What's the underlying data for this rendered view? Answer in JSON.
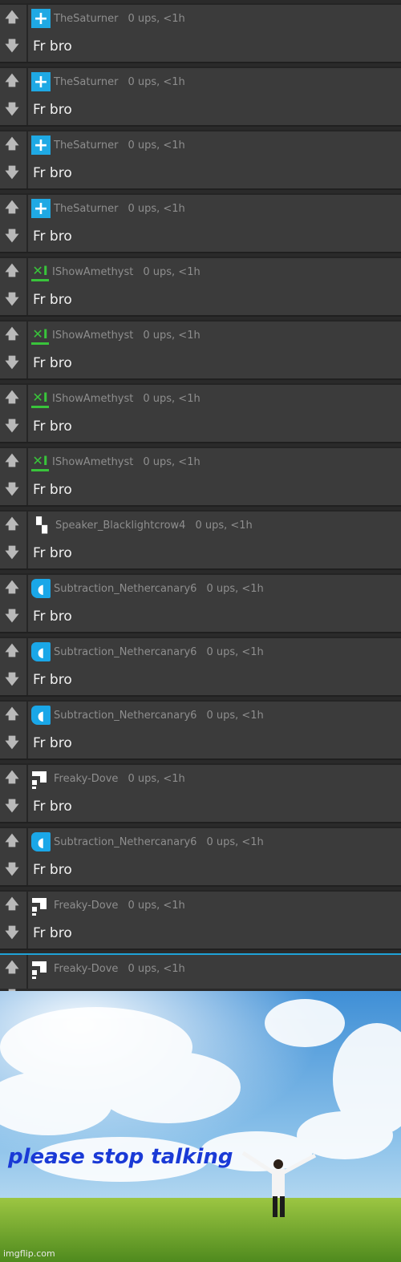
{
  "comments": [
    {
      "user": "TheSaturner",
      "meta": "0 ups, <1h",
      "text": "Fr bro",
      "avatar": "blue-plus-icon"
    },
    {
      "user": "TheSaturner",
      "meta": "0 ups, <1h",
      "text": "Fr bro",
      "avatar": "blue-plus-icon"
    },
    {
      "user": "TheSaturner",
      "meta": "0 ups, <1h",
      "text": "Fr bro",
      "avatar": "blue-plus-icon"
    },
    {
      "user": "TheSaturner",
      "meta": "0 ups, <1h",
      "text": "Fr bro",
      "avatar": "blue-plus-icon"
    },
    {
      "user": "IShowAmethyst",
      "meta": "0 ups, <1h",
      "text": "Fr bro",
      "avatar": "green-xi-icon"
    },
    {
      "user": "IShowAmethyst",
      "meta": "0 ups, <1h",
      "text": "Fr bro",
      "avatar": "green-xi-icon"
    },
    {
      "user": "IShowAmethyst",
      "meta": "0 ups, <1h",
      "text": "Fr bro",
      "avatar": "green-xi-icon"
    },
    {
      "user": "IShowAmethyst",
      "meta": "0 ups, <1h",
      "text": "Fr bro",
      "avatar": "green-xi-icon"
    },
    {
      "user": "Speaker_Blacklightcrow4",
      "meta": "0 ups, <1h",
      "text": "Fr bro",
      "avatar": "white-speaker-icon"
    },
    {
      "user": "Subtraction_Nethercanary6",
      "meta": "0 ups, <1h",
      "text": "Fr bro",
      "avatar": "blue-pixel-icon"
    },
    {
      "user": "Subtraction_Nethercanary6",
      "meta": "0 ups, <1h",
      "text": "Fr bro",
      "avatar": "blue-pixel-icon"
    },
    {
      "user": "Subtraction_Nethercanary6",
      "meta": "0 ups, <1h",
      "text": "Fr bro",
      "avatar": "blue-pixel-icon"
    },
    {
      "user": "Freaky-Dove",
      "meta": "0 ups, <1h",
      "text": "Fr bro",
      "avatar": "white-pixel-icon"
    },
    {
      "user": "Subtraction_Nethercanary6",
      "meta": "0 ups, <1h",
      "text": "Fr bro",
      "avatar": "blue-pixel-icon"
    },
    {
      "user": "Freaky-Dove",
      "meta": "0 ups, <1h",
      "text": "Fr bro",
      "avatar": "white-pixel-icon"
    },
    {
      "user": "Freaky-Dove",
      "meta": "0 ups, <1h",
      "text": "",
      "avatar": "white-pixel-icon"
    }
  ],
  "meme": {
    "caption": "please stop talking",
    "watermark": "imgflip.com"
  },
  "colors": {
    "background": "#3b3b3b",
    "username": "#8e8e8e",
    "text": "#f0f0f0",
    "accent": "#1fa3d8",
    "caption": "#1a3ad6"
  }
}
